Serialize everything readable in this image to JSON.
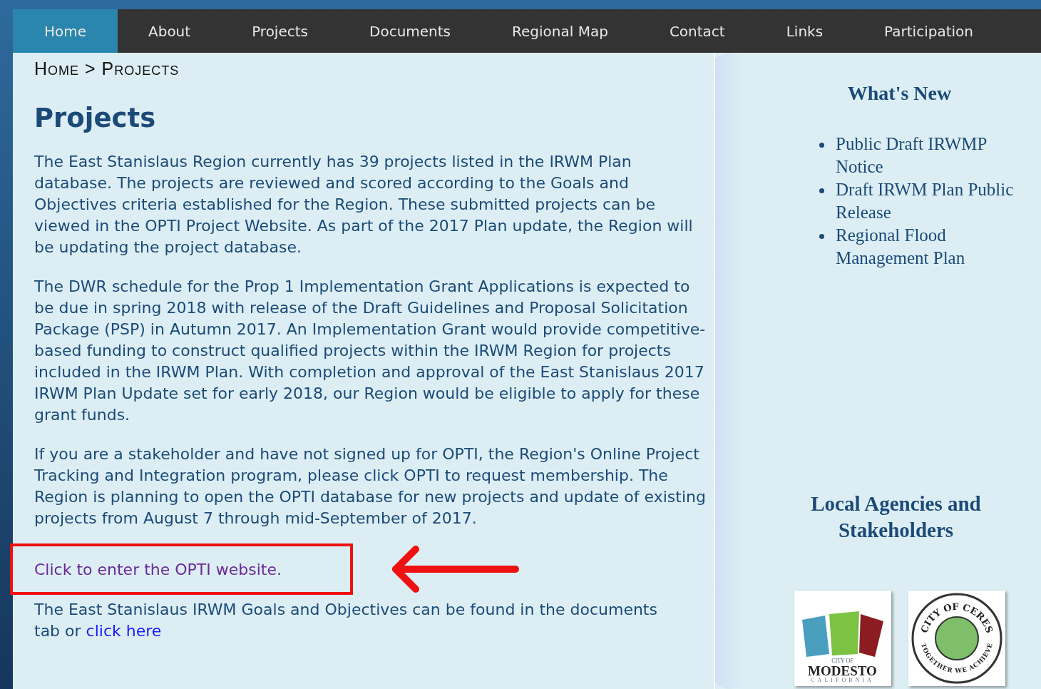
{
  "nav": [
    {
      "label": "Home",
      "selected": true
    },
    {
      "label": "About",
      "selected": false
    },
    {
      "label": "Projects",
      "selected": false
    },
    {
      "label": "Documents",
      "selected": false
    },
    {
      "label": "Regional Map",
      "selected": false
    },
    {
      "label": "Contact",
      "selected": false
    },
    {
      "label": "Links",
      "selected": false
    },
    {
      "label": "Participation",
      "selected": false
    }
  ],
  "breadcrumb": "Home > Projects",
  "title": "Projects",
  "paragraphs": [
    "The East Stanislaus Region currently has 39 projects listed in the IRWM Plan database. The projects are reviewed and scored according to the Goals and Objectives criteria established for the Region. These submitted projects can be viewed in the OPTI Project Website. As part of the 2017 Plan update, the Region will be updating the project database.",
    "The DWR schedule for the Prop 1 Implementation Grant Applications is expected to be due in spring 2018 with release of the Draft Guidelines and Proposal Solicitation Package (PSP) in Autumn 2017. An Implementation Grant would provide competitive-based funding to construct qualified projects within the IRWM Region for projects included in the IRWM Plan. With completion and approval of the East Stanislaus 2017 IRWM Plan Update set for early 2018, our Region would be eligible to apply for these grant funds.",
    "If you are a stakeholder and have not signed up for OPTI, the Region's Online Project Tracking and Integration program, please click OPTI to request membership. The Region is planning to open the OPTI database for new projects and update of existing projects from August 7 through mid-September of 2017."
  ],
  "opti_link": "Click to enter the OPTI website.",
  "goals": {
    "text": "The East Stanislaus IRWM Goals and Objectives can be found in the documents tab or ",
    "link": "click here"
  },
  "sidebar": {
    "news_title": "What's New",
    "news": [
      "Public Draft IRWMP Notice",
      "Draft IRWM Plan Public Release",
      "Regional Flood Management Plan"
    ],
    "agencies_title": "Local Agencies and Stakeholders",
    "logos": [
      {
        "kind": "modesto",
        "small": "CITY OF",
        "name": "MODESTO",
        "sub": "CALIFORNIA"
      },
      {
        "kind": "ceres",
        "top": "CITY OF CERES",
        "bottom": "TOGETHER WE ACHIEVE"
      }
    ]
  }
}
